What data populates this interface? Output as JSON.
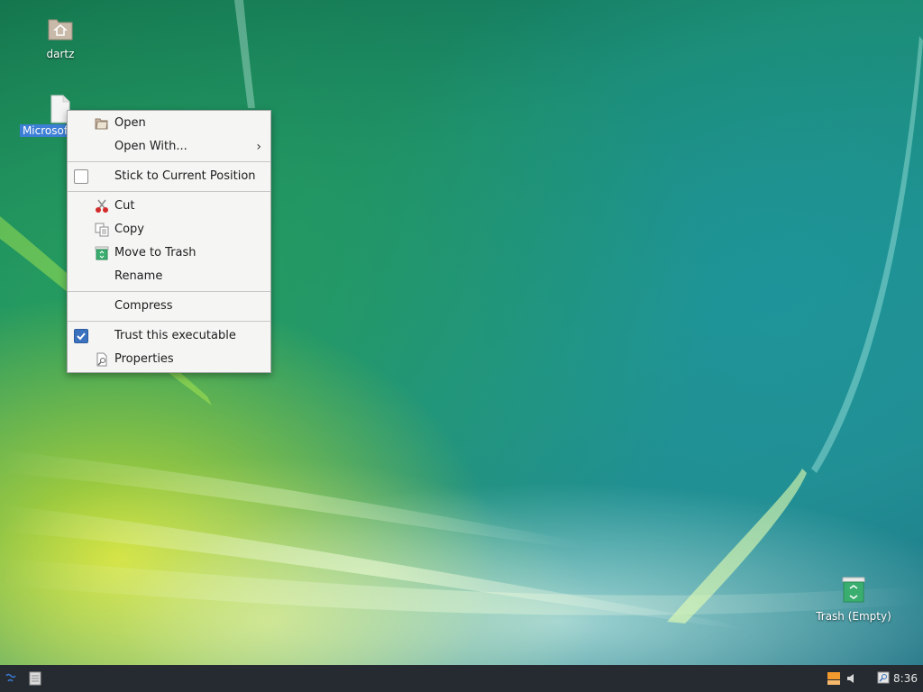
{
  "desktop": {
    "icons": [
      {
        "label": "dartz",
        "icon": "home-folder-icon"
      },
      {
        "label": "Microsof",
        "icon": "file-icon",
        "selected": true
      },
      {
        "label": "Trash (Empty)",
        "icon": "trash-icon"
      }
    ]
  },
  "context_menu": {
    "items": {
      "open": {
        "label": "Open",
        "icon": "folder-open-icon"
      },
      "open_with": {
        "label": "Open With...",
        "icon": "chevron-right-icon"
      },
      "stick": {
        "label": "Stick to Current Position",
        "checked": false
      },
      "cut": {
        "label": "Cut",
        "icon": "scissors-icon"
      },
      "copy": {
        "label": "Copy",
        "icon": "copy-icon"
      },
      "move_to_trash": {
        "label": "Move to Trash",
        "icon": "trash-icon"
      },
      "rename": {
        "label": "Rename"
      },
      "compress": {
        "label": "Compress"
      },
      "trust": {
        "label": "Trust this executable",
        "checked": true
      },
      "properties": {
        "label": "Properties",
        "icon": "properties-icon"
      }
    }
  },
  "taskbar": {
    "clock": "8:36",
    "icons": [
      "start-menu-icon",
      "show-desktop-icon",
      "network-icon",
      "volume-icon",
      "notification-icon"
    ]
  },
  "colors": {
    "selection": "#3d7fd6",
    "menu_bg": "#f5f5f4",
    "taskbar_bg": "#262b31",
    "checkbox_on": "#3a72c0"
  }
}
